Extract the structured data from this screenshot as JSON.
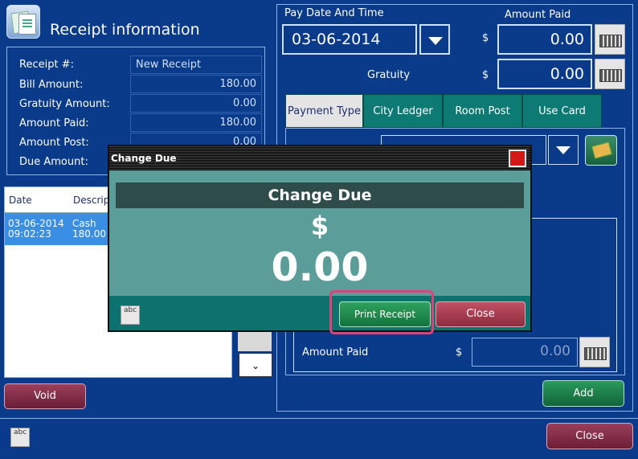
{
  "header": {
    "title": "Receipt information"
  },
  "receipt": {
    "receipt_no_label": "Receipt #:",
    "receipt_no_value": "New Receipt",
    "bill_amount_label": "Bill Amount:",
    "bill_amount_value": "180.00",
    "gratuity_amount_label": "Gratuity Amount:",
    "gratuity_amount_value": "0.00",
    "amount_paid_label": "Amount Paid:",
    "amount_paid_value": "180.00",
    "amount_post_label": "Amount Post:",
    "amount_post_value": "0.00",
    "due_amount_label": "Due Amount:"
  },
  "payments_list": {
    "headers": [
      "Date",
      "Descrip"
    ],
    "rows": [
      {
        "date": "03-06-2014",
        "time": "09:02:23",
        "desc": "Cash",
        "amount": "180.00"
      }
    ]
  },
  "left_buttons": {
    "void_label": "Void"
  },
  "pay": {
    "date_time_label": "Pay Date And Time",
    "date_value": "03-06-2014",
    "amount_paid_label": "Amount Paid",
    "currency": "$",
    "amount_paid_value": "0.00",
    "gratuity_label": "Gratuity",
    "gratuity_value": "0.00"
  },
  "tabs": [
    {
      "label": "Payment Type",
      "active": true
    },
    {
      "label": "City Ledger",
      "active": false
    },
    {
      "label": "Room Post",
      "active": false
    },
    {
      "label": "Use Card",
      "active": false
    }
  ],
  "payment_panel": {
    "amount_paid_label": "Amount Paid",
    "currency": "$",
    "amount_paid_value": "0.00",
    "add_label": "Add"
  },
  "bottom": {
    "close_label": "Close",
    "spell_icon_text": "abc"
  },
  "modal": {
    "title": "Change Due",
    "heading": "Change Due",
    "currency": "$",
    "amount": "0.00",
    "print_label": "Print Receipt",
    "close_label": "Close",
    "spell_icon_text": "abc"
  },
  "colors": {
    "background": "#0a3a8a",
    "tab_teal": "#0e7a74",
    "modal_teal": "#5b9d98",
    "highlight": "#e0417a"
  }
}
